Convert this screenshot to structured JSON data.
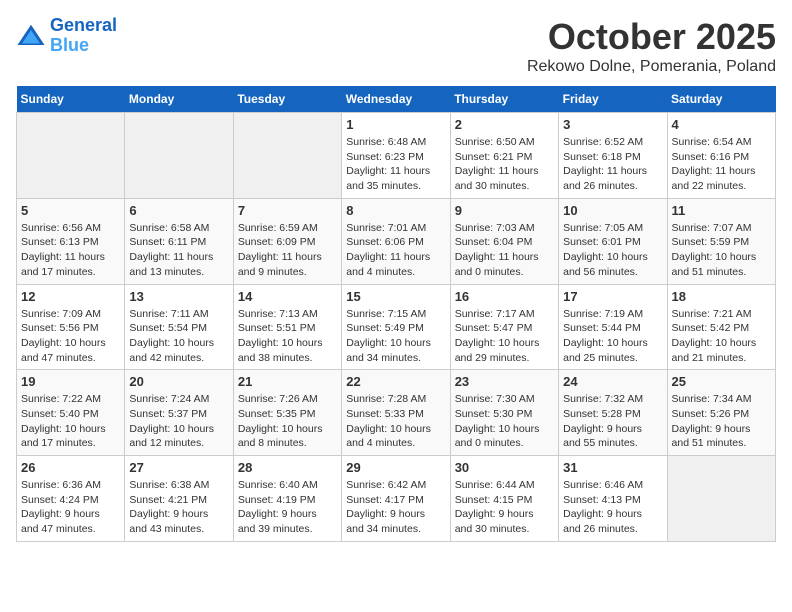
{
  "logo": {
    "line1": "General",
    "line2": "Blue"
  },
  "title": "October 2025",
  "subtitle": "Rekowo Dolne, Pomerania, Poland",
  "days_of_week": [
    "Sunday",
    "Monday",
    "Tuesday",
    "Wednesday",
    "Thursday",
    "Friday",
    "Saturday"
  ],
  "weeks": [
    [
      {
        "day": "",
        "info": ""
      },
      {
        "day": "",
        "info": ""
      },
      {
        "day": "",
        "info": ""
      },
      {
        "day": "1",
        "info": "Sunrise: 6:48 AM\nSunset: 6:23 PM\nDaylight: 11 hours\nand 35 minutes."
      },
      {
        "day": "2",
        "info": "Sunrise: 6:50 AM\nSunset: 6:21 PM\nDaylight: 11 hours\nand 30 minutes."
      },
      {
        "day": "3",
        "info": "Sunrise: 6:52 AM\nSunset: 6:18 PM\nDaylight: 11 hours\nand 26 minutes."
      },
      {
        "day": "4",
        "info": "Sunrise: 6:54 AM\nSunset: 6:16 PM\nDaylight: 11 hours\nand 22 minutes."
      }
    ],
    [
      {
        "day": "5",
        "info": "Sunrise: 6:56 AM\nSunset: 6:13 PM\nDaylight: 11 hours\nand 17 minutes."
      },
      {
        "day": "6",
        "info": "Sunrise: 6:58 AM\nSunset: 6:11 PM\nDaylight: 11 hours\nand 13 minutes."
      },
      {
        "day": "7",
        "info": "Sunrise: 6:59 AM\nSunset: 6:09 PM\nDaylight: 11 hours\nand 9 minutes."
      },
      {
        "day": "8",
        "info": "Sunrise: 7:01 AM\nSunset: 6:06 PM\nDaylight: 11 hours\nand 4 minutes."
      },
      {
        "day": "9",
        "info": "Sunrise: 7:03 AM\nSunset: 6:04 PM\nDaylight: 11 hours\nand 0 minutes."
      },
      {
        "day": "10",
        "info": "Sunrise: 7:05 AM\nSunset: 6:01 PM\nDaylight: 10 hours\nand 56 minutes."
      },
      {
        "day": "11",
        "info": "Sunrise: 7:07 AM\nSunset: 5:59 PM\nDaylight: 10 hours\nand 51 minutes."
      }
    ],
    [
      {
        "day": "12",
        "info": "Sunrise: 7:09 AM\nSunset: 5:56 PM\nDaylight: 10 hours\nand 47 minutes."
      },
      {
        "day": "13",
        "info": "Sunrise: 7:11 AM\nSunset: 5:54 PM\nDaylight: 10 hours\nand 42 minutes."
      },
      {
        "day": "14",
        "info": "Sunrise: 7:13 AM\nSunset: 5:51 PM\nDaylight: 10 hours\nand 38 minutes."
      },
      {
        "day": "15",
        "info": "Sunrise: 7:15 AM\nSunset: 5:49 PM\nDaylight: 10 hours\nand 34 minutes."
      },
      {
        "day": "16",
        "info": "Sunrise: 7:17 AM\nSunset: 5:47 PM\nDaylight: 10 hours\nand 29 minutes."
      },
      {
        "day": "17",
        "info": "Sunrise: 7:19 AM\nSunset: 5:44 PM\nDaylight: 10 hours\nand 25 minutes."
      },
      {
        "day": "18",
        "info": "Sunrise: 7:21 AM\nSunset: 5:42 PM\nDaylight: 10 hours\nand 21 minutes."
      }
    ],
    [
      {
        "day": "19",
        "info": "Sunrise: 7:22 AM\nSunset: 5:40 PM\nDaylight: 10 hours\nand 17 minutes."
      },
      {
        "day": "20",
        "info": "Sunrise: 7:24 AM\nSunset: 5:37 PM\nDaylight: 10 hours\nand 12 minutes."
      },
      {
        "day": "21",
        "info": "Sunrise: 7:26 AM\nSunset: 5:35 PM\nDaylight: 10 hours\nand 8 minutes."
      },
      {
        "day": "22",
        "info": "Sunrise: 7:28 AM\nSunset: 5:33 PM\nDaylight: 10 hours\nand 4 minutes."
      },
      {
        "day": "23",
        "info": "Sunrise: 7:30 AM\nSunset: 5:30 PM\nDaylight: 10 hours\nand 0 minutes."
      },
      {
        "day": "24",
        "info": "Sunrise: 7:32 AM\nSunset: 5:28 PM\nDaylight: 9 hours\nand 55 minutes."
      },
      {
        "day": "25",
        "info": "Sunrise: 7:34 AM\nSunset: 5:26 PM\nDaylight: 9 hours\nand 51 minutes."
      }
    ],
    [
      {
        "day": "26",
        "info": "Sunrise: 6:36 AM\nSunset: 4:24 PM\nDaylight: 9 hours\nand 47 minutes."
      },
      {
        "day": "27",
        "info": "Sunrise: 6:38 AM\nSunset: 4:21 PM\nDaylight: 9 hours\nand 43 minutes."
      },
      {
        "day": "28",
        "info": "Sunrise: 6:40 AM\nSunset: 4:19 PM\nDaylight: 9 hours\nand 39 minutes."
      },
      {
        "day": "29",
        "info": "Sunrise: 6:42 AM\nSunset: 4:17 PM\nDaylight: 9 hours\nand 34 minutes."
      },
      {
        "day": "30",
        "info": "Sunrise: 6:44 AM\nSunset: 4:15 PM\nDaylight: 9 hours\nand 30 minutes."
      },
      {
        "day": "31",
        "info": "Sunrise: 6:46 AM\nSunset: 4:13 PM\nDaylight: 9 hours\nand 26 minutes."
      },
      {
        "day": "",
        "info": ""
      }
    ]
  ]
}
